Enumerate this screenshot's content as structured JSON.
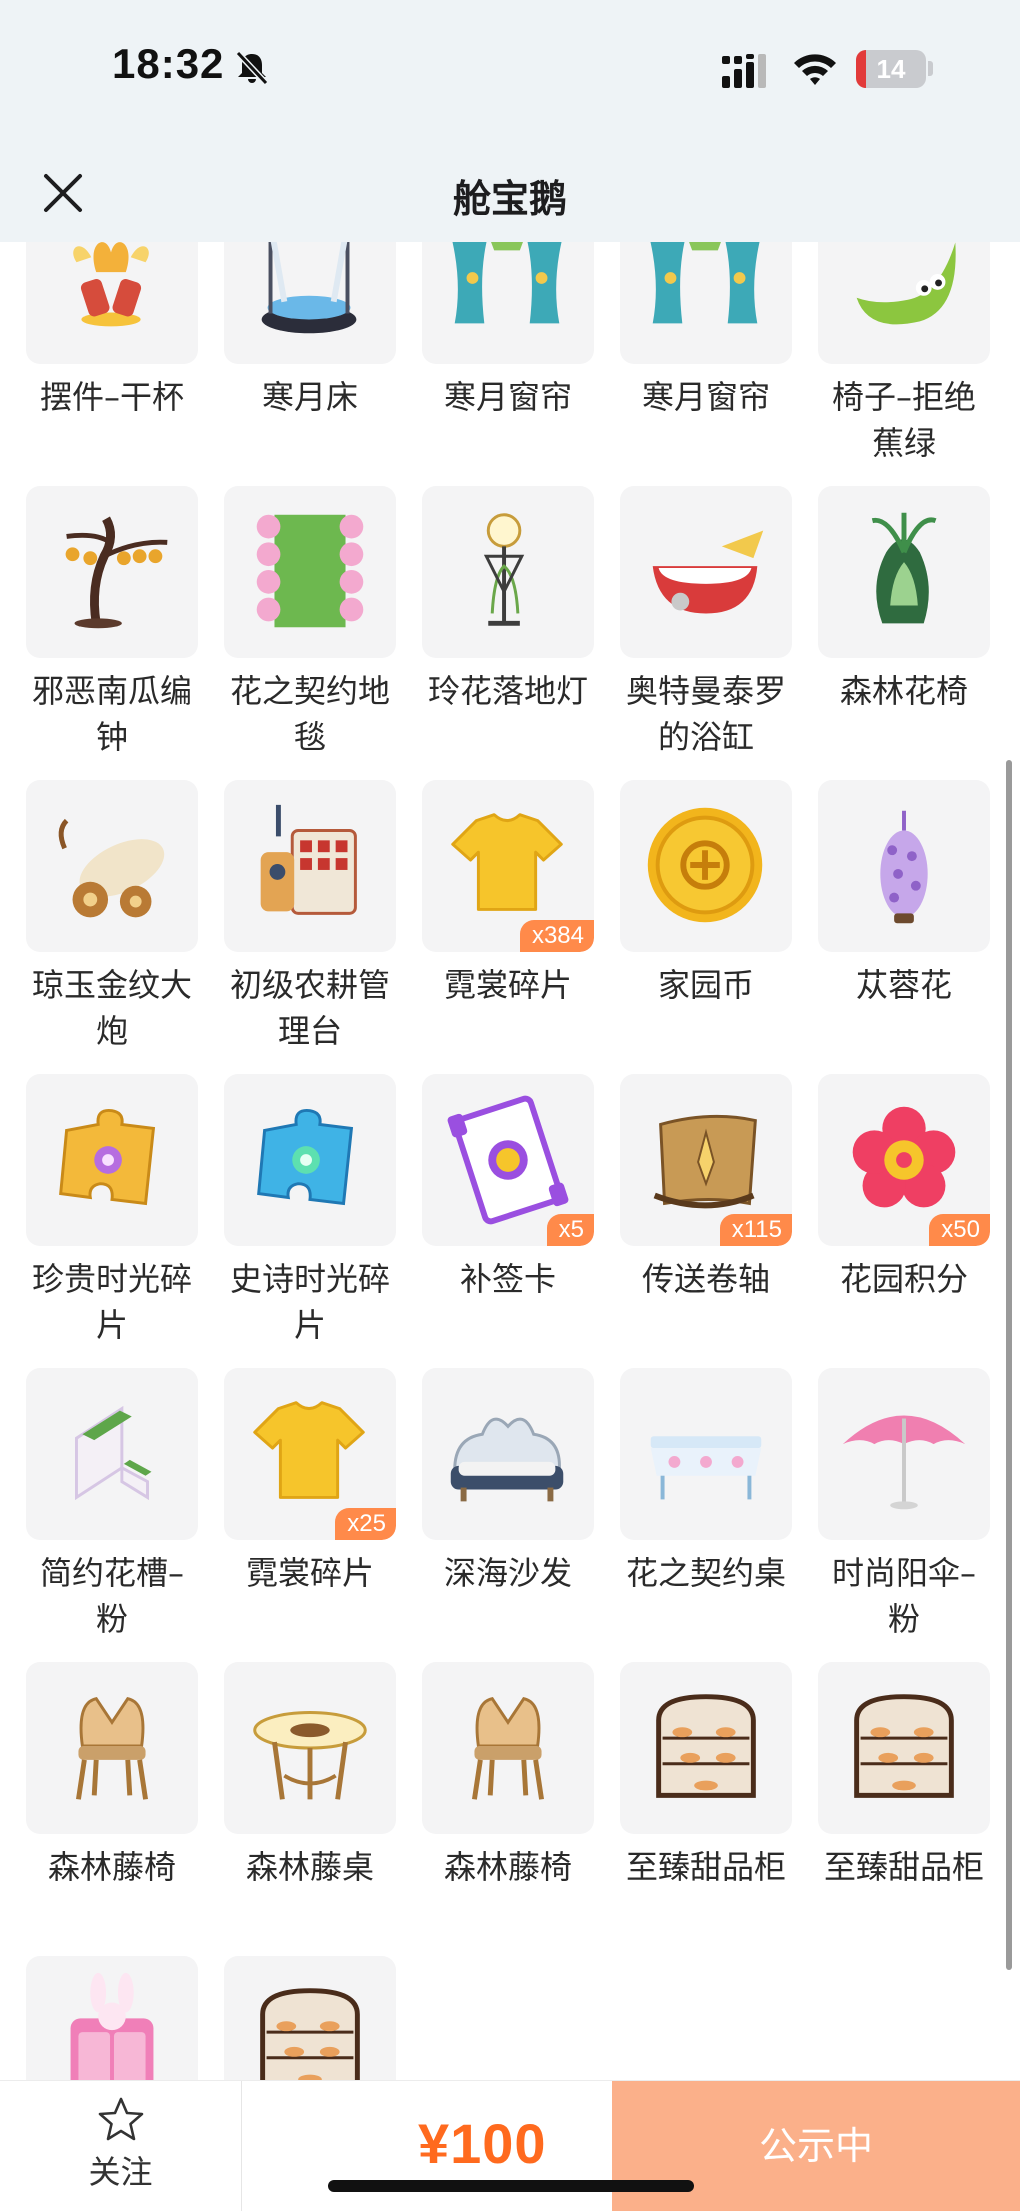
{
  "status_bar": {
    "time": "18:32",
    "battery": "14",
    "battery_level": 0.14,
    "icons": [
      "bell-slash-icon",
      "signal-icon",
      "wifi-icon",
      "battery-icon"
    ]
  },
  "header": {
    "title": "舱宝鹅",
    "close_icon": "close-icon"
  },
  "colors": {
    "accent": "#ff6a1e",
    "badge": "#ff8a4a",
    "button": "#fbb08a",
    "thumb_bg": "#f4f4f5",
    "header_bg": "#eef3f6"
  },
  "items": [
    {
      "name": "摆件–干杯",
      "art": "cheers-icon"
    },
    {
      "name": "寒月床",
      "art": "bed-icon"
    },
    {
      "name": "寒月窗帘",
      "art": "curtain-icon"
    },
    {
      "name": "寒月窗帘",
      "art": "curtain-icon"
    },
    {
      "name": "椅子–拒绝蕉绿",
      "art": "banana-chair-icon"
    },
    {
      "name": "邪恶南瓜编钟",
      "art": "pumpkin-chime-icon"
    },
    {
      "name": "花之契约地毯",
      "art": "flower-rug-icon"
    },
    {
      "name": "玲花落地灯",
      "art": "floor-lamp-icon"
    },
    {
      "name": "奥特曼泰罗的浴缸",
      "art": "bathtub-icon"
    },
    {
      "name": "森林花椅",
      "art": "forest-chair-icon"
    },
    {
      "name": "琼玉金纹大炮",
      "art": "cannon-icon"
    },
    {
      "name": "初级农耕管理台",
      "art": "farm-console-icon"
    },
    {
      "name": "霓裳碎片",
      "art": "tshirt-icon",
      "badge": "x384"
    },
    {
      "name": "家园币",
      "art": "coin-icon"
    },
    {
      "name": "苁蓉花",
      "art": "cistanche-icon"
    },
    {
      "name": "珍贵时光碎片",
      "art": "gold-puzzle-icon"
    },
    {
      "name": "史诗时光碎片",
      "art": "blue-puzzle-icon"
    },
    {
      "name": "补签卡",
      "art": "ticket-icon",
      "badge": "x5"
    },
    {
      "name": "传送卷轴",
      "art": "scroll-icon",
      "badge": "x115"
    },
    {
      "name": "花园积分",
      "art": "flower-token-icon",
      "badge": "x50"
    },
    {
      "name": "简约花槽–粉",
      "art": "planter-icon"
    },
    {
      "name": "霓裳碎片",
      "art": "tshirt-icon",
      "badge": "x25"
    },
    {
      "name": "深海沙发",
      "art": "sofa-icon"
    },
    {
      "name": "花之契约桌",
      "art": "table-cloth-icon"
    },
    {
      "name": "时尚阳伞–粉",
      "art": "parasol-icon"
    },
    {
      "name": "森林藤椅",
      "art": "rattan-chair-icon"
    },
    {
      "name": "森林藤桌",
      "art": "rattan-table-icon"
    },
    {
      "name": "森林藤椅",
      "art": "rattan-chair-icon"
    },
    {
      "name": "至臻甜品柜",
      "art": "dessert-cabinet-icon"
    },
    {
      "name": "至臻甜品柜",
      "art": "dessert-cabinet-icon"
    },
    {
      "name": "",
      "art": "rabbit-wardrobe-icon"
    },
    {
      "name": "",
      "art": "dessert-cabinet-icon"
    }
  ],
  "footer": {
    "follow_label": "关注",
    "follow_icon": "star-outline-icon",
    "price": "¥100",
    "status_button": "公示中"
  }
}
